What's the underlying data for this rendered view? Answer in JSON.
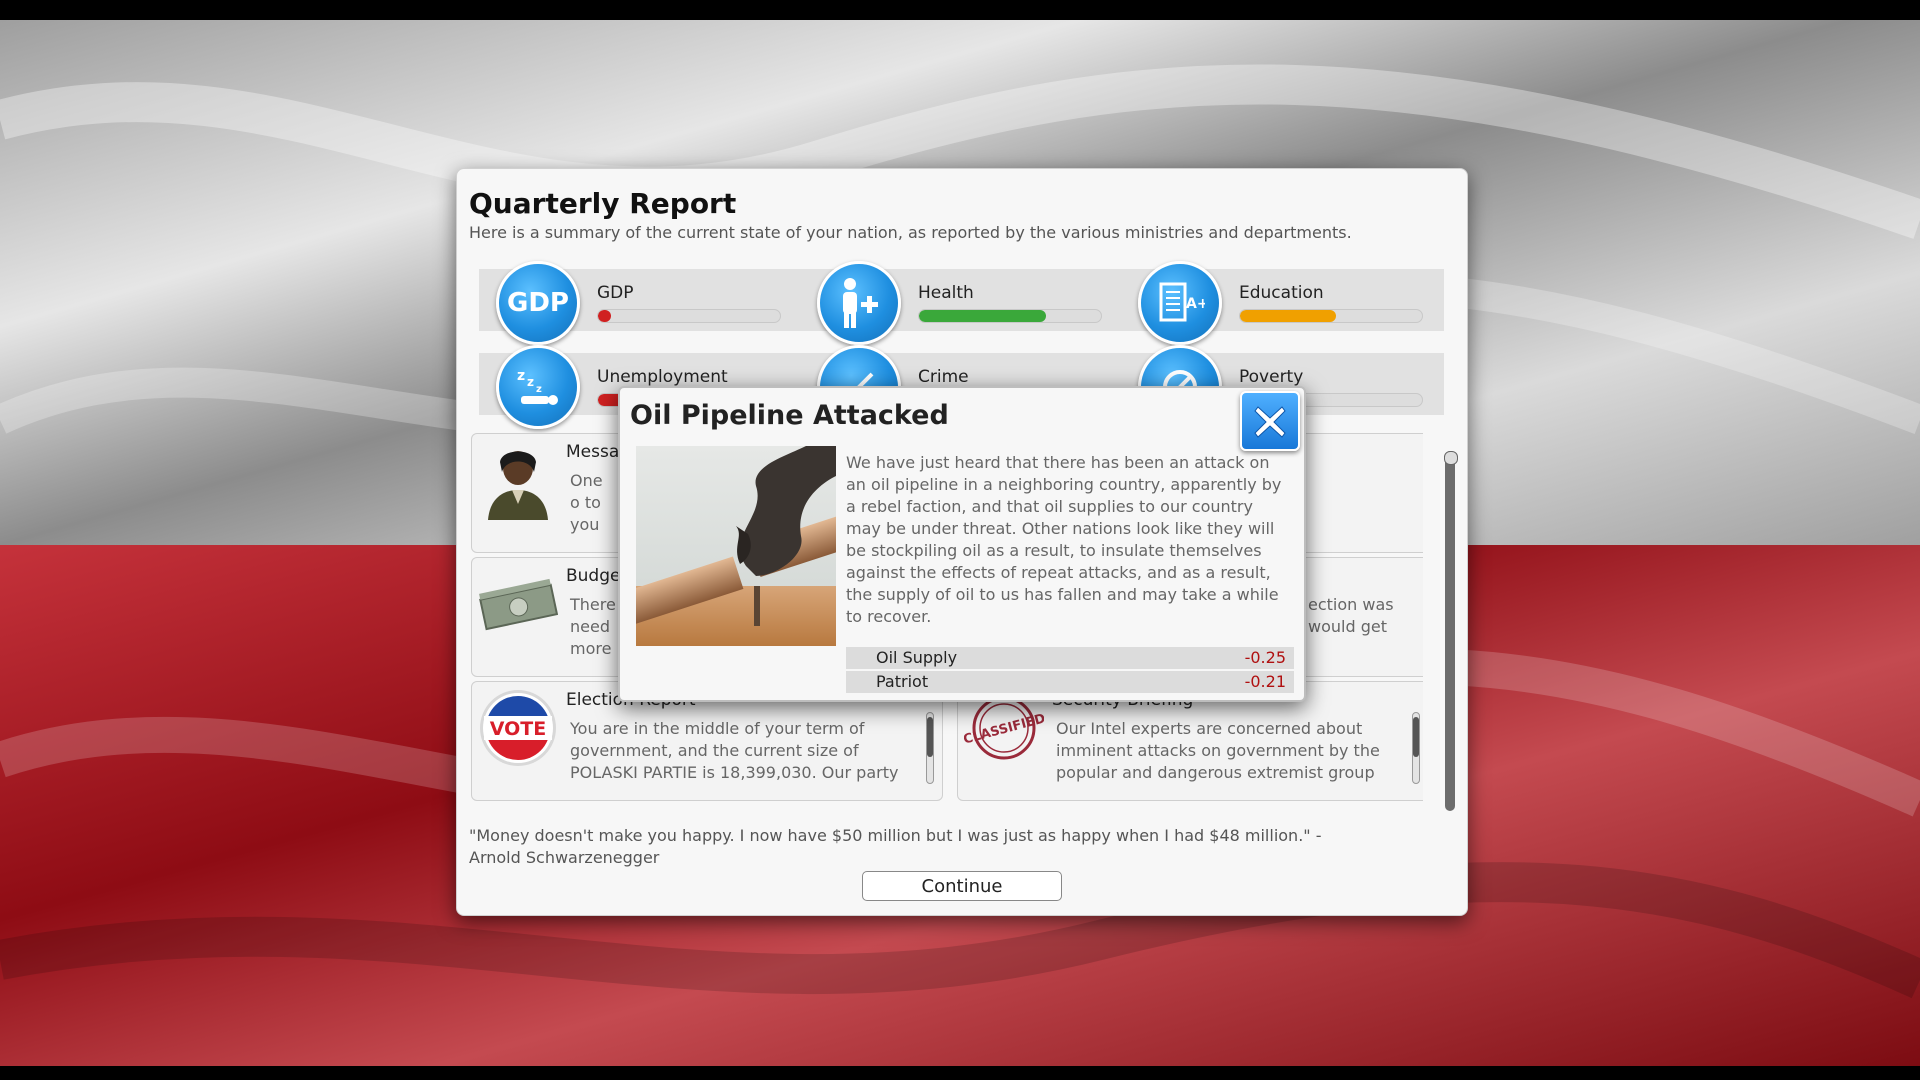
{
  "report": {
    "title": "Quarterly Report",
    "subtitle": "Here is a summary of the current state of your nation, as reported by the various ministries and departments.",
    "stats": [
      {
        "label": "GDP",
        "icon": "gdp-icon",
        "level_pct": 5,
        "color": "#d02020"
      },
      {
        "label": "Health",
        "icon": "health-icon",
        "level_pct": 70,
        "color": "#3aa83a"
      },
      {
        "label": "Education",
        "icon": "education-icon",
        "level_pct": 53,
        "color": "#f0a000"
      },
      {
        "label": "Unemployment",
        "icon": "sleeping-worker-icon",
        "level_pct": 15,
        "color": "#d02020"
      },
      {
        "label": "Crime",
        "icon": "crime-icon",
        "level_pct": 0,
        "color": "#d02020"
      },
      {
        "label": "Poverty",
        "icon": "poverty-icon",
        "level_pct": 0,
        "color": "#d02020"
      }
    ],
    "cards": [
      {
        "title": "Messa",
        "text": "One o to you"
      },
      {
        "title": "",
        "text": ""
      },
      {
        "title": "Budge",
        "text": "There need more"
      },
      {
        "title": "",
        "text": "ection was would get"
      },
      {
        "title": "Election Report",
        "text": "You are in the middle of your term of government, and the current size of POLASKI PARTIE is 18,399,030. Our party"
      },
      {
        "title": "Security Briefing",
        "text": "Our Intel experts are concerned about imminent attacks on government by the popular and dangerous extremist group"
      }
    ],
    "vote_text": "VOTE",
    "classified_text": "CLASSIFIED",
    "quote": "\"Money doesn't make you happy. I now have $50 million but I was just as happy when I had $48 million.\" - Arnold Schwarzenegger",
    "continue_label": "Continue"
  },
  "modal": {
    "title": "Oil Pipeline Attacked",
    "body": "We have just heard that there has been an attack on an oil pipeline in a neighboring country, apparently by a rebel faction, and that oil supplies to our country may be under threat. Other nations look like they will be stockpiling oil as a result, to insulate themselves against the effects of repeat attacks, and as a result, the supply of oil to us has fallen and may take a while to recover.",
    "effects": [
      {
        "name": "Oil Supply",
        "value": "-0.25"
      },
      {
        "name": "Patriot",
        "value": "-0.21"
      }
    ]
  },
  "colors": {
    "flag_white": "#e8e8e8",
    "flag_red": "#b3111b",
    "accent_blue": "#1f8fe0",
    "negative": "#b01010"
  }
}
